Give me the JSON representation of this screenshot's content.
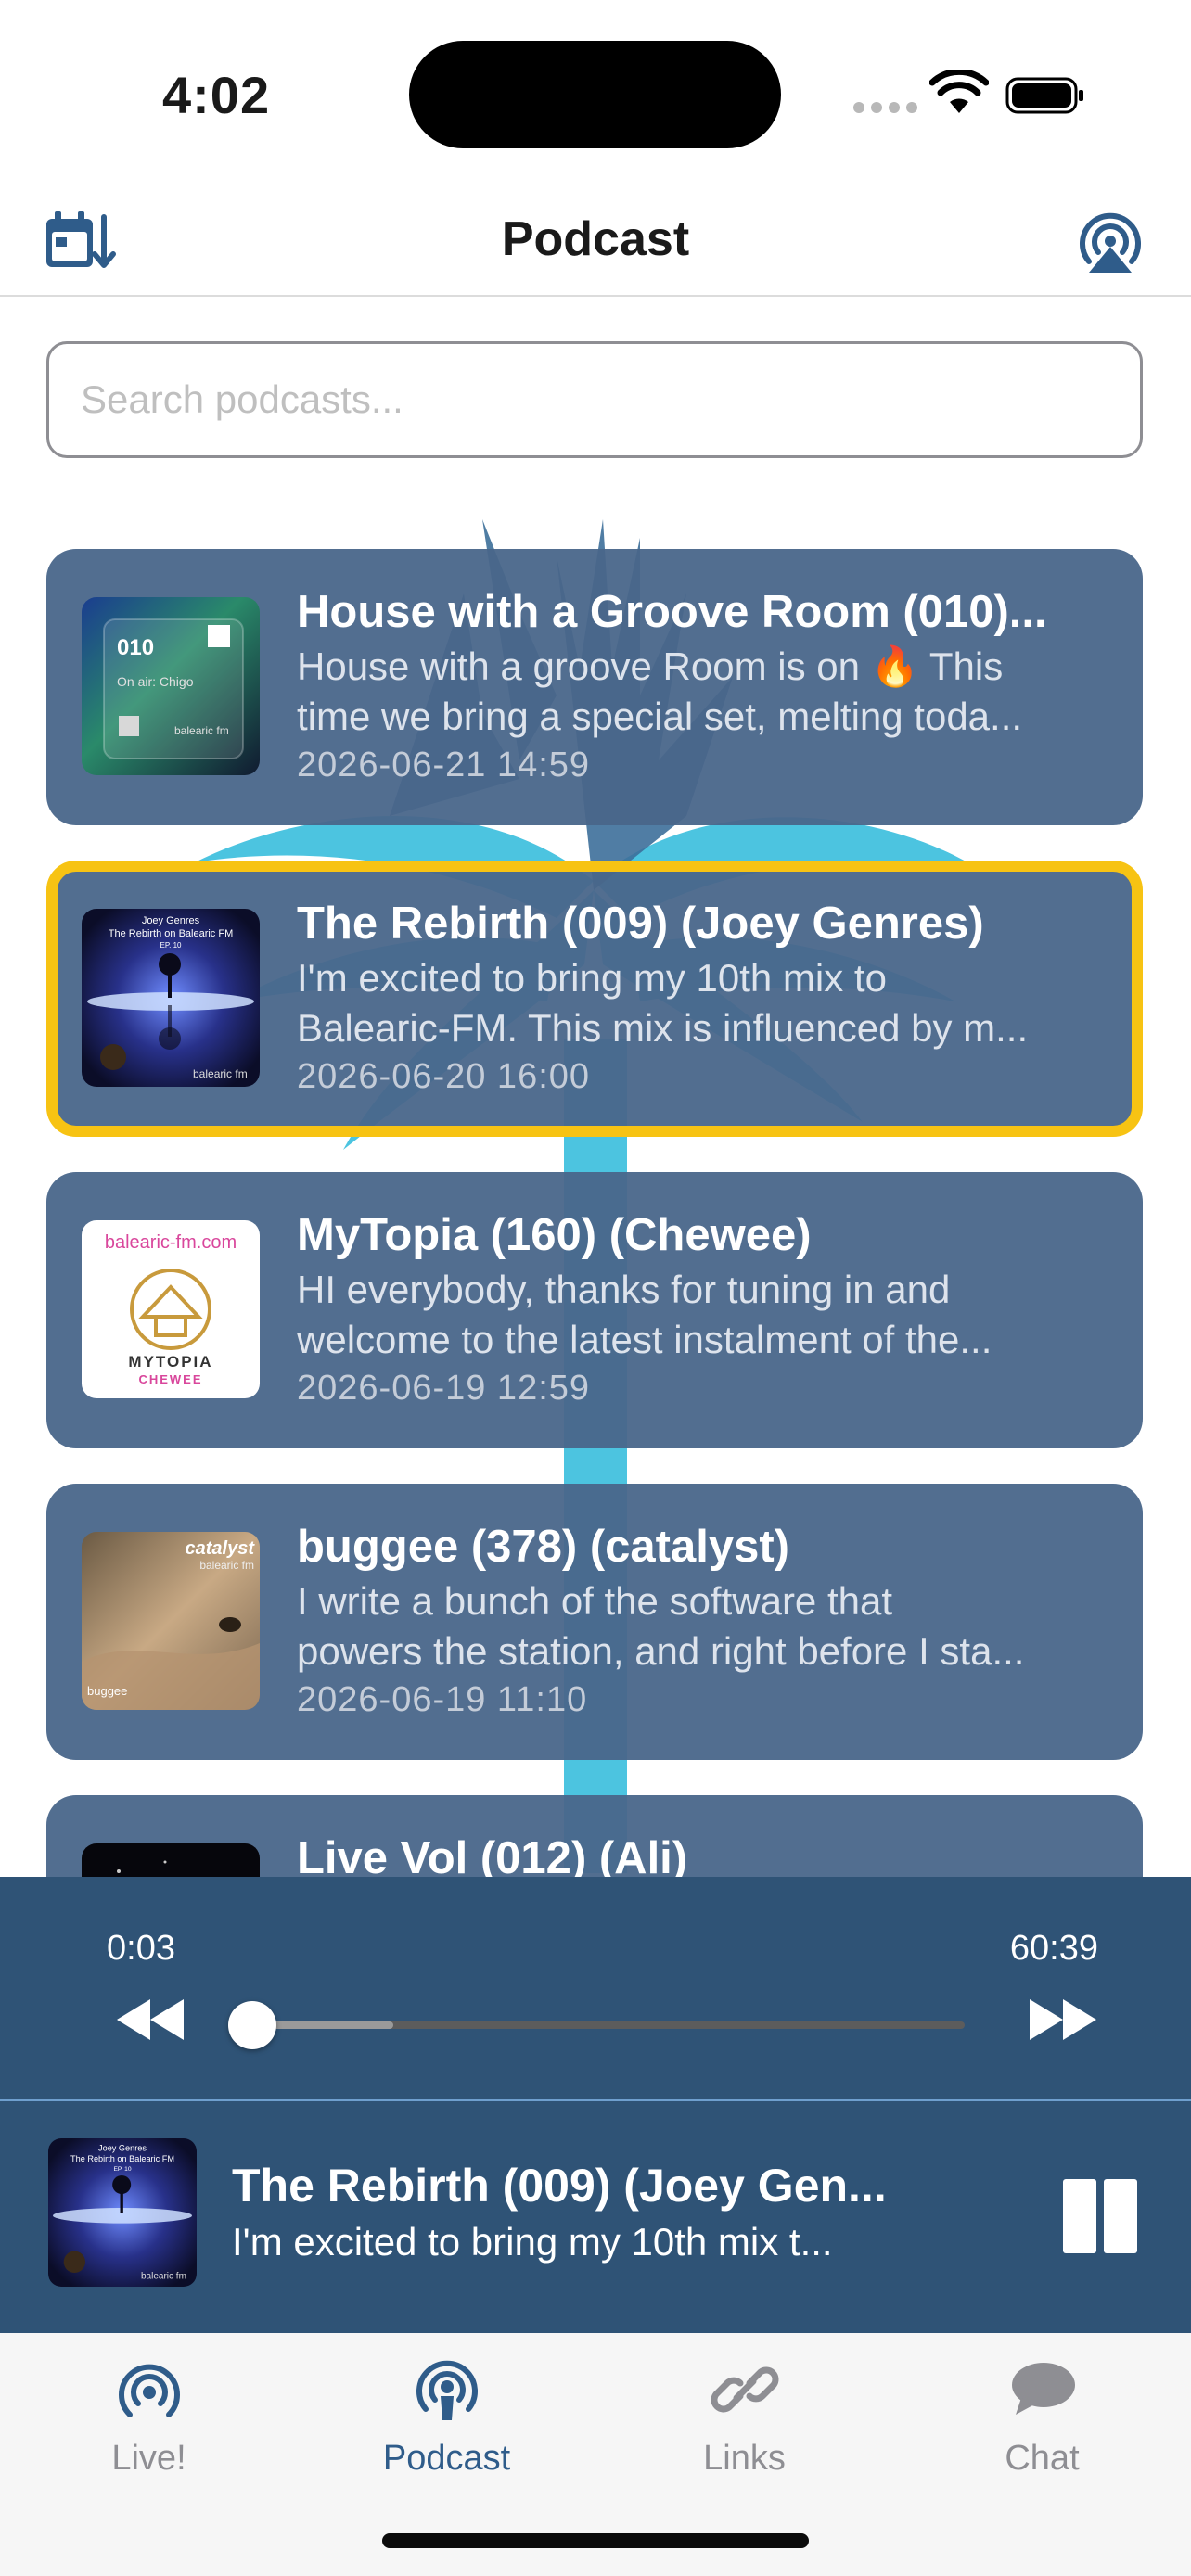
{
  "status_bar": {
    "time": "4:02"
  },
  "nav": {
    "title": "Podcast"
  },
  "search": {
    "placeholder": "Search podcasts..."
  },
  "episodes": [
    {
      "title": "House with a Groove Room (010)...",
      "desc_line1": "House with a groove Room is on 🔥 This",
      "desc_line2": "time we bring a special set, melting toda...",
      "date": "2026-06-21 14:59",
      "thumb_code": "010",
      "thumb_caption": "On air: Chigo",
      "thumb_brand": "balearic fm"
    },
    {
      "title": "The Rebirth (009) (Joey Genres)",
      "desc_line1": "I'm excited to bring my 10th mix to",
      "desc_line2": "Balearic-FM. This mix is influenced by m...",
      "date": "2026-06-20 16:00",
      "thumb_artist": "Joey Genres",
      "thumb_show": "The Rebirth on Balearic FM",
      "thumb_ep": "EP. 10",
      "thumb_brand": "balearic fm"
    },
    {
      "title": "MyTopia (160) (Chewee)",
      "desc_line1": "HI everybody, thanks for tuning in and",
      "desc_line2": "welcome to the latest instalment of the...",
      "date": "2026-06-19 12:59",
      "thumb_site": "balearic-fm.com",
      "thumb_name": "MYTOPIA",
      "thumb_artist": "CHEWEE"
    },
    {
      "title": "buggee (378) (catalyst)",
      "desc_line1": "I write a bunch of the software that",
      "desc_line2": "powers the station, and right before I sta...",
      "date": "2026-06-19 11:10",
      "thumb_brand_top": "catalyst",
      "thumb_brand": "balearic fm",
      "thumb_name": "buggee"
    },
    {
      "title": "Live Vol (012) (Ali)"
    }
  ],
  "player": {
    "current_time": "0:03",
    "total_time": "60:39",
    "progress": 0.002,
    "buffered": 0.2
  },
  "mini_player": {
    "title": "The Rebirth (009) (Joey Gen...",
    "subtitle": "I'm excited to bring my 10th mix t..."
  },
  "tabs": [
    {
      "label": "Live!",
      "icon": "broadcast-icon"
    },
    {
      "label": "Podcast",
      "icon": "podcast-icon",
      "active": true
    },
    {
      "label": "Links",
      "icon": "link-icon"
    },
    {
      "label": "Chat",
      "icon": "chat-bubble-icon"
    }
  ],
  "colors": {
    "card_bg": "#49668a",
    "selected_border": "#f7c313",
    "player_bg": "#2f5376",
    "accent": "#2f5c8a",
    "palm": "#4cc4e0"
  }
}
